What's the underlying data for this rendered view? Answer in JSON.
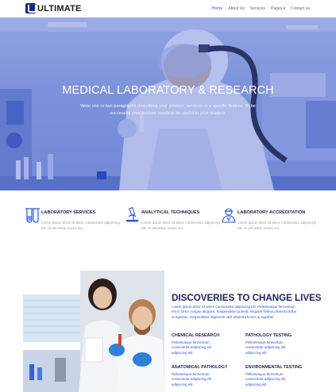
{
  "nav": {
    "logo_text": "ULTIMATE",
    "items": [
      "Home",
      "About Us",
      "Services",
      "Pages ▾",
      "Contact us"
    ],
    "active_index": 0
  },
  "hero": {
    "title": "MEDICAL LABORATORY & RESEARCH",
    "subtitle": "Write one or two paragraphs describing your product, services or a specific feature. To be successful your content needs to be useful to your readers."
  },
  "features": [
    {
      "icon": "test-tubes-icon",
      "title": "LABORATORY SERVICES",
      "text": "Lorem ipsum dolor sit amet, consectetur adipiscing elit. Ut elit tellus, luctus nec."
    },
    {
      "icon": "microscope-icon",
      "title": "ANALYTICAL TECHNIQUES",
      "text": "Lorem ipsum dolor sit amet, consectetur adipiscing elit. Ut elit tellus, luctus nec."
    },
    {
      "icon": "scientist-icon",
      "title": "LABORATORY ACCREDITATION",
      "text": "Lorem ipsum dolor sit amet, consectetur adipiscing elit. Ut elit tellus, luctus nec."
    }
  ],
  "discoveries": {
    "title": "DISCOVERIES TO CHANGE LIVES",
    "text": "Lorem ipsum dolor sit amet, consectetur adipiscing elit. Pellentesque fermentum est in tortor congue aliquam. Suspendisse potenti. Aliquam finibus pharetra tellus at egestas. Suspendisse dignissim velit pharetra lectus at egestas.",
    "items": [
      {
        "title": "CHEMICAL RESEARCH",
        "text": "Pellentesque fermentum consectetur adipiscing elit adipiscing elit."
      },
      {
        "title": "PATHOLOGY TESTING",
        "text": "Pellentesque fermentum consectetur adipiscing elit adipiscing elit."
      },
      {
        "title": "ANATOMICAL PATHOLOGY",
        "text": "Pellentesque fermentum consectetur adipiscing elit adipiscing elit."
      },
      {
        "title": "ENVIRONMENTAL TESTING",
        "text": "Pellentesque fermentum consectetur adipiscing elit adipiscing elit."
      }
    ]
  },
  "colors": {
    "accent": "#2c56d8",
    "heading": "#1b2356",
    "logo": "#1b2a78"
  }
}
